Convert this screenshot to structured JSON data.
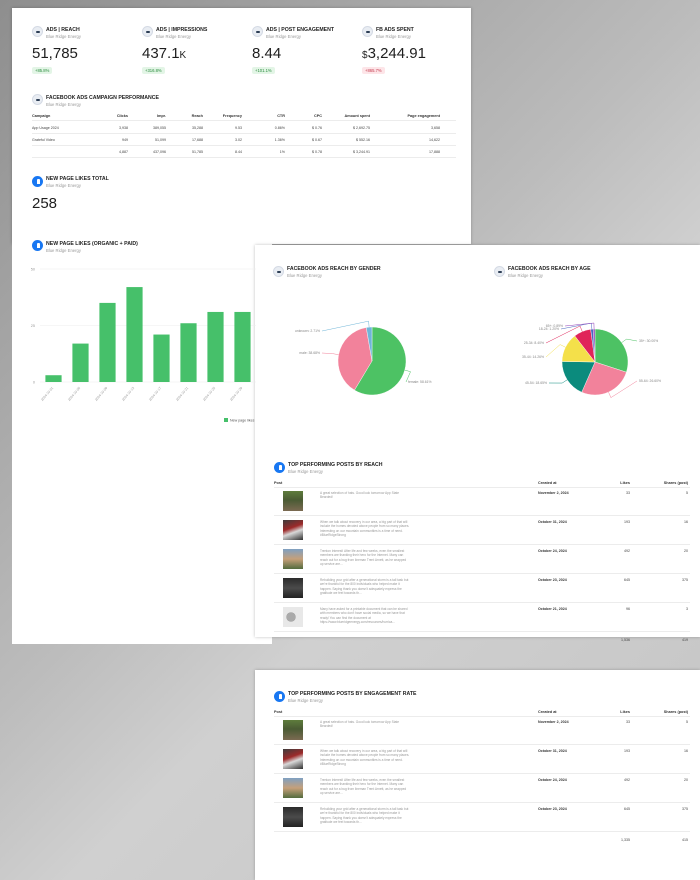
{
  "kpis": [
    {
      "title": "ADS | REACH",
      "sub": "Blue Ridge Energy",
      "value": "51,785",
      "unit": "",
      "badge": "+85.8%",
      "trend": "up"
    },
    {
      "title": "ADS | IMPRESSIONS",
      "sub": "Blue Ridge Energy",
      "value": "437.1",
      "unit": "K",
      "badge": "+316.8%",
      "trend": "up"
    },
    {
      "title": "ADS | POST ENGAGEMENT",
      "sub": "Blue Ridge Energy",
      "value": "8.44",
      "unit": "",
      "badge": "+101.1%",
      "trend": "up"
    },
    {
      "title": "FB ADS SPENT",
      "sub": "Blue Ridge Energy",
      "currency": "$",
      "value": "3,244.91",
      "badge": "+865.7%",
      "trend": "down"
    }
  ],
  "campaign": {
    "title": "FACEBOOK ADS CAMPAIGN PERFORMANCE",
    "sub": "Blue Ridge Energy",
    "headers": [
      "Campaign",
      "Clicks",
      "Impr.",
      "Reach",
      "Frequency",
      "CTR",
      "CPC",
      "Amount spent",
      "Page engagement"
    ],
    "rows": [
      [
        "App Usage 2024",
        "3,938",
        "389,055",
        "35,288",
        "9.53",
        "0.86%",
        "$ 0.76",
        "$ 2,692.75",
        "3,658"
      ],
      [
        "Grateful Video",
        "949",
        "51,099",
        "17,688",
        "3.02",
        "1.36%",
        "$ 0.67",
        "$ 552.16",
        "14,622"
      ],
      [
        "",
        "4,887",
        "437,096",
        "51,785",
        "8.44",
        "1%",
        "$ 0.78",
        "$ 3,244.91",
        "17,888"
      ]
    ]
  },
  "likes_total": {
    "title": "NEW PAGE LIKES TOTAL",
    "sub": "Blue Ridge Energy",
    "value": "258"
  },
  "likes_chart": {
    "title": "NEW PAGE LIKES (ORGANIC + PAID)",
    "sub": "Blue Ridge Energy"
  },
  "chart_data": [
    {
      "type": "bar",
      "title": "NEW PAGE LIKES (ORGANIC + PAID)",
      "categories": [
        "2024-10-01",
        "2024-10-05",
        "2024-10-09",
        "2024-10-13",
        "2024-10-17",
        "2024-10-21",
        "2024-10-25",
        "2024-10-29"
      ],
      "series": [
        {
          "name": "New page likes",
          "values": [
            3,
            17,
            35,
            42,
            21,
            26,
            31,
            31
          ]
        }
      ],
      "ylim": [
        0,
        50
      ],
      "yticks": [
        "0",
        "25",
        "50"
      ],
      "legend": "bottom-right",
      "color": "#46c06a"
    },
    {
      "type": "pie",
      "title": "FACEBOOK ADS REACH BY GENDER",
      "labels": [
        "female: 58.61%",
        "male: 38.68%",
        "unknown: 2.71%"
      ],
      "values": [
        58.61,
        38.68,
        2.71
      ],
      "colors": [
        "#4dc264",
        "#f2829b",
        "#6fb5d8"
      ]
    },
    {
      "type": "pie",
      "title": "FACEBOOK ADS REACH BY AGE",
      "labels": [
        "35+: 30.00%",
        "55-64: 26.60%",
        "45-54: 18.65%",
        "35-44: 14.26%",
        "25-34: 8.40%",
        "18-24: 1.20%",
        "65+: 0.89%"
      ],
      "values": [
        30.0,
        26.6,
        18.65,
        14.26,
        8.4,
        1.2,
        0.89
      ],
      "colors": [
        "#4dc264",
        "#f2829b",
        "#0b8b7d",
        "#f4e04a",
        "#e0245a",
        "#4a66c0",
        "#8f3fb8"
      ]
    }
  ],
  "gender": {
    "title": "FACEBOOK ADS REACH BY GENDER",
    "sub": "Blue Ridge Energy"
  },
  "age": {
    "title": "FACEBOOK ADS REACH BY AGE",
    "sub": "Blue Ridge Energy"
  },
  "top_reach": {
    "title": "TOP PERFORMING POSTS BY REACH",
    "sub": "Blue Ridge Energy",
    "headers": [
      "Post",
      "Created at",
      "Likes",
      "Shares (post)"
    ],
    "posts": [
      {
        "text": "A great selection of hats. Good luck tomorrow App State Bearded!",
        "date": "November 2, 2024",
        "likes": "33",
        "shares": "5"
      },
      {
        "text": "When we talk about recovery in our area, a big part of that will include the homes devoted above people from so many places. Interesting on our mountain communities is a time of need. #BlueRidgeStrong",
        "date": "October 31, 2024",
        "likes": "193",
        "shares": "16"
      },
      {
        "text": "Trenton Interest! After life and few weeks, even the smallest members are thanking their hero for the Internet. Many can reach out for a bug from lineman Trent Arnett, as he wrapped up service are...",
        "date": "October 24, 2024",
        "likes": "492",
        "shares": "20"
      },
      {
        "text": "Rebuilding your grid after a generational storm is a tall task but we're thankful for the 800 individuals who helped make it happen. Saying thank you doesn't adequately express the gratitude we feel towards th...",
        "date": "October 23, 2024",
        "likes": "645",
        "shares": "375"
      },
      {
        "text": "Many have asked for a printable document that can be shared with members who don't have social media, so we have that ready! You can find the document at https://www.blueridgeenergy.com/resources/hurrica...",
        "date": "October 21, 2024",
        "likes": "96",
        "shares": "3"
      }
    ],
    "totals": {
      "likes": "1,536",
      "shares": "419"
    }
  },
  "top_eng": {
    "title": "TOP PERFORMING POSTS BY ENGAGEMENT RATE",
    "sub": "Blue Ridge Energy",
    "headers": [
      "Post",
      "Created at",
      "Likes",
      "Shares (post)"
    ],
    "posts": [
      {
        "text": "A great selection of hats. Good luck tomorrow App State Bearded!",
        "date": "November 2, 2024",
        "likes": "33",
        "shares": "5"
      },
      {
        "text": "When we talk about recovery in our area, a big part of that will include the homes devoted above people from so many places. Interesting on our mountain communities is a time of need. #BlueRidgeStrong",
        "date": "October 31, 2024",
        "likes": "193",
        "shares": "16"
      },
      {
        "text": "Trenton Interest! After life and few weeks, even the smallest members are thanking their hero for the Internet. Many can reach out for a bug from lineman Trent Arnett, as he wrapped up service are...",
        "date": "October 24, 2024",
        "likes": "492",
        "shares": "20"
      },
      {
        "text": "Rebuilding your grid after a generational storm is a tall task but we're thankful for the 800 individuals who helped make it happen. Saying thank you doesn't adequately express the gratitude we feel towards th...",
        "date": "October 23, 2024",
        "likes": "645",
        "shares": "375"
      }
    ],
    "totals": {
      "likes": "1,335",
      "shares": "415"
    }
  }
}
